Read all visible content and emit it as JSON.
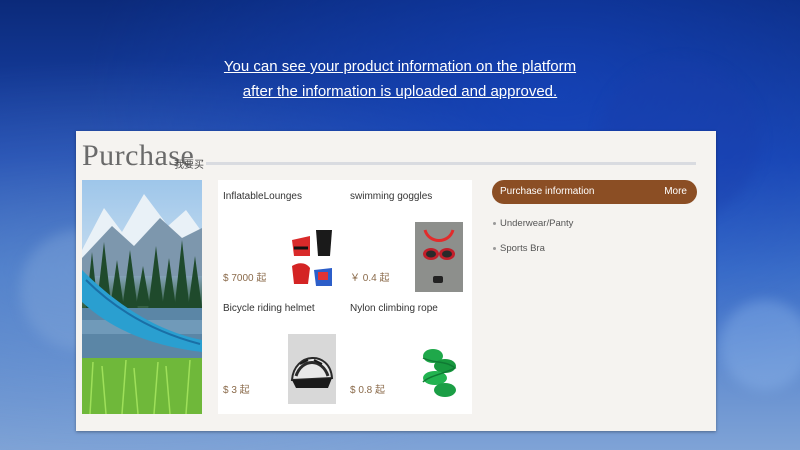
{
  "caption": {
    "line1": "You can see your product information on the platform",
    "line2": "after the information is uploaded and approved."
  },
  "section": {
    "title": "Purchase",
    "subtitle": "我要买"
  },
  "products": [
    {
      "name": "InflatableLounges",
      "price": "$ 7000 起"
    },
    {
      "name": "swimming goggles",
      "price": "￥ 0.4 起"
    },
    {
      "name": "Bicycle riding helmet",
      "price": "$ 3 起"
    },
    {
      "name": "Nylon climbing rope",
      "price": "$ 0.8 起"
    }
  ],
  "purchase_info": {
    "title": "Purchase information",
    "more": "More",
    "items": [
      "Underwear/Panty",
      "Sports Bra"
    ]
  },
  "colors": {
    "panel_bg": "#f5f3f0",
    "accent_brown": "#8b4e24",
    "price_text": "#8a6a4a",
    "background_blue": "#1b47b0"
  }
}
